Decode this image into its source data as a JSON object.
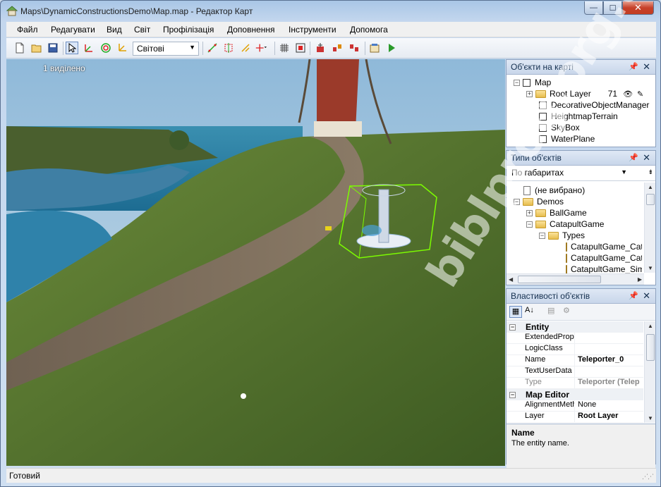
{
  "window": {
    "title": "Maps\\DynamicConstructionsDemo\\Map.map - Редактор Карт",
    "minimize_glyph": "—",
    "maximize_glyph": "☐",
    "close_glyph": "✕"
  },
  "menu": [
    {
      "label": "Файл"
    },
    {
      "label": "Редагувати"
    },
    {
      "label": "Вид"
    },
    {
      "label": "Світ"
    },
    {
      "label": "Профілізація"
    },
    {
      "label": "Доповнення"
    },
    {
      "label": "Інструменти"
    },
    {
      "label": "Допомога"
    }
  ],
  "toolbar": {
    "coord_space": "Світові",
    "icons": [
      "new-icon",
      "open-icon",
      "save-icon",
      "select-icon",
      "move-icon",
      "rotate-icon",
      "scale-icon",
      "snap-icon",
      "transform-icon",
      "align-icon",
      "transform-tool-icon",
      "grid-icon",
      "focus-icon",
      "add-object-icon",
      "cut-objects-icon",
      "properties-icon",
      "play-icon"
    ]
  },
  "viewport": {
    "selected_label": "1 виділено"
  },
  "map_objects_panel": {
    "title": "Об'єкти на карті",
    "items": [
      {
        "label": "Map",
        "indent": 0,
        "expander": "−",
        "icon": "checkbox"
      },
      {
        "label": "Root Layer",
        "indent": 1,
        "expander": "+",
        "icon": "folder",
        "count": "71"
      },
      {
        "label": "DecorativeObjectManager",
        "indent": 2,
        "icon": "checkbox"
      },
      {
        "label": "HeightmapTerrain",
        "indent": 2,
        "icon": "checkbox"
      },
      {
        "label": "SkyBox",
        "indent": 2,
        "icon": "checkbox"
      },
      {
        "label": "WaterPlane",
        "indent": 2,
        "icon": "checkbox"
      }
    ]
  },
  "object_types_panel": {
    "title": "Типи об'єктів",
    "sort_value": "По габаритах",
    "items": [
      {
        "label": "(не вибрано)",
        "indent": 0,
        "icon": "doc"
      },
      {
        "label": "Demos",
        "indent": 0,
        "expander": "−",
        "icon": "folder"
      },
      {
        "label": "BallGame",
        "indent": 1,
        "expander": "+",
        "icon": "folder"
      },
      {
        "label": "CatapultGame",
        "indent": 1,
        "expander": "−",
        "icon": "folder"
      },
      {
        "label": "Types",
        "indent": 2,
        "expander": "−",
        "icon": "folder"
      },
      {
        "label": "CatapultGame_Cata",
        "indent": 3,
        "icon": "cylinder"
      },
      {
        "label": "CatapultGame_Cata",
        "indent": 3,
        "icon": "cylinder"
      },
      {
        "label": "CatapultGame_Sim",
        "indent": 3,
        "icon": "cylinder"
      }
    ]
  },
  "properties_panel": {
    "title": "Властивості об'єктів",
    "categories": [
      {
        "label": "Entity",
        "expander": "−"
      },
      {
        "label": "Map Editor",
        "expander": "−"
      }
    ],
    "rows": [
      {
        "key": "ExtendedProp",
        "value": "",
        "bold": false,
        "dim": false
      },
      {
        "key": "LogicClass",
        "value": "",
        "bold": false,
        "dim": false
      },
      {
        "key": "Name",
        "value": "Teleporter_0",
        "bold": true,
        "dim": false
      },
      {
        "key": "TextUserData",
        "value": "",
        "bold": false,
        "dim": false
      },
      {
        "key": "Type",
        "value": "Teleporter (Telep",
        "bold": true,
        "dim": true
      },
      {
        "key": "AlignmentMeth",
        "value": "None",
        "bold": false,
        "dim": false
      },
      {
        "key": "Layer",
        "value": "Root Layer",
        "bold": true,
        "dim": false
      }
    ],
    "description": {
      "title": "Name",
      "text": "The entity name."
    }
  },
  "statusbar": {
    "text": "Готовий"
  },
  "watermark": "biblprog.org.ua",
  "colors": {
    "accent": "#3b6ea5",
    "selection_box": "#7cfc00",
    "close_button": "#c6402a"
  }
}
